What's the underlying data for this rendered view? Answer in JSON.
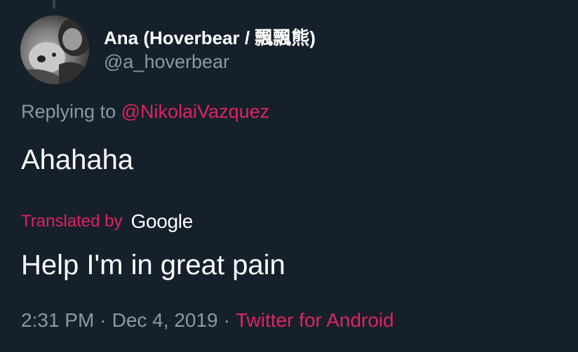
{
  "tweet": {
    "author_name": "Ana (Hoverbear / 飄飄熊)",
    "author_handle": "@a_hoverbear",
    "replying_prefix": "Replying to",
    "replying_to": "@NikolaiVazquez",
    "text": "Ahahaha",
    "translated_prefix": "Translated by",
    "translator": "Google",
    "translated_text": "Help I'm in great pain",
    "time": "2:31 PM",
    "date": "Dec 4, 2019",
    "separator": "·",
    "source": "Twitter for Android"
  },
  "colors": {
    "background": "#15202b",
    "primary_text": "#ffffff",
    "secondary_text": "#8899a6",
    "accent": "#e0245e"
  }
}
